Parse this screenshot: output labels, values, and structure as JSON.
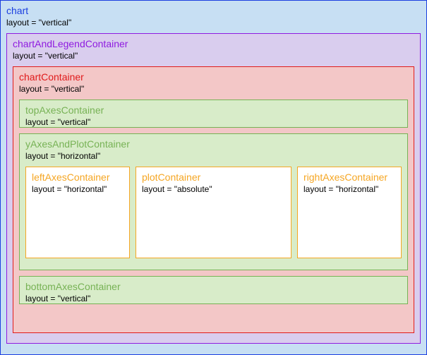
{
  "chart": {
    "title": "chart",
    "layout": "layout = \"vertical\""
  },
  "chartAndLegend": {
    "title": "chartAndLegendContainer",
    "layout": "layout = \"vertical\""
  },
  "chartContainer": {
    "title": "chartContainer",
    "layout": "layout = \"vertical\""
  },
  "topAxes": {
    "title": "topAxesContainer",
    "layout": "layout = \"vertical\""
  },
  "yAxesAndPlot": {
    "title": "yAxesAndPlotContainer",
    "layout": "layout = \"horizontal\""
  },
  "leftAxes": {
    "title": "leftAxesContainer",
    "layout": "layout = \"horizontal\""
  },
  "plot": {
    "title": "plotContainer",
    "layout": "layout = \"absolute\""
  },
  "rightAxes": {
    "title": "rightAxesContainer",
    "layout": "layout = \"horizontal\""
  },
  "bottomAxes": {
    "title": "bottomAxesContainer",
    "layout": "layout = \"vertical\""
  }
}
